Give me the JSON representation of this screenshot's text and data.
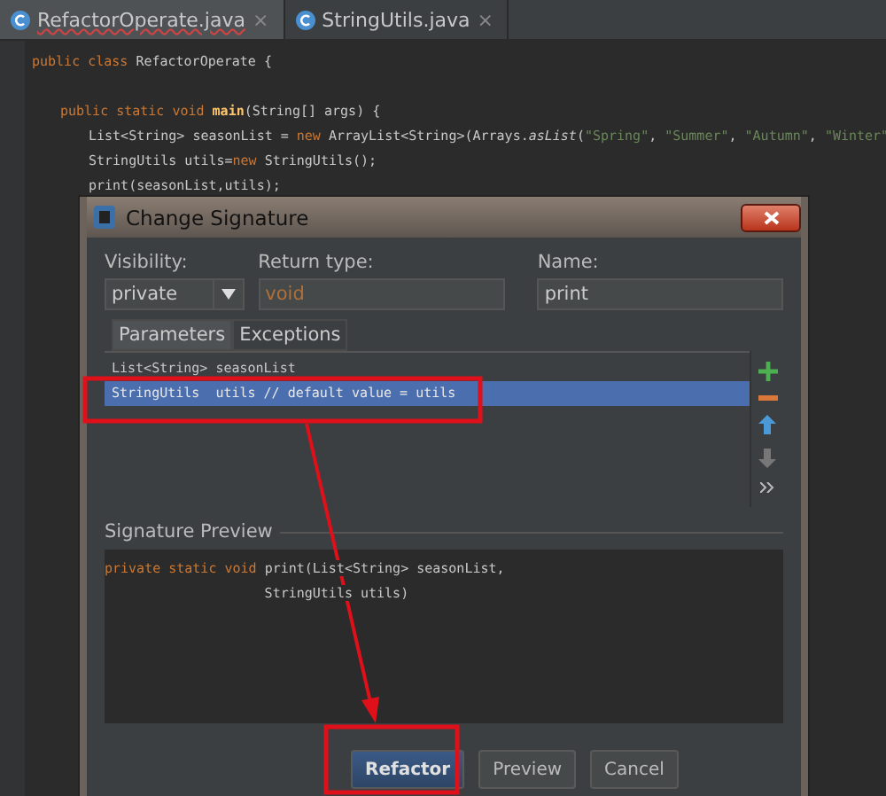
{
  "editor_tabs": [
    {
      "label": "RefactorOperate.java",
      "selected": true,
      "close": "×"
    },
    {
      "label": "StringUtils.java",
      "selected": false,
      "close": "×"
    }
  ],
  "code": [
    {
      "tokens": [
        {
          "kind": "keyword",
          "text": "public class "
        },
        {
          "kind": "plain",
          "text": "RefactorOperate {"
        }
      ],
      "children": [
        {
          "tokens": [
            {
              "kind": "keyword",
              "text": "public static void "
            },
            {
              "kind": "bold",
              "text": "main"
            },
            {
              "kind": "plain",
              "text": "(String[] args) {"
            }
          ],
          "children": [
            {
              "tokens": [
                {
                  "kind": "plain",
                  "text": "List<String> seasonList = "
                },
                {
                  "kind": "keyword",
                  "text": "new "
                },
                {
                  "kind": "plain",
                  "text": "ArrayList<String>(Arrays."
                },
                {
                  "kind": "italic",
                  "text": "asList"
                },
                {
                  "kind": "plain",
                  "text": "("
                },
                {
                  "kind": "string",
                  "text": "\"Spring\""
                },
                {
                  "kind": "plain",
                  "text": ", "
                },
                {
                  "kind": "string",
                  "text": "\"Summer\""
                },
                {
                  "kind": "plain",
                  "text": ", "
                },
                {
                  "kind": "string",
                  "text": "\"Autumn\""
                },
                {
                  "kind": "plain",
                  "text": ", "
                },
                {
                  "kind": "string",
                  "text": "\"Winter\""
                }
              ]
            },
            {
              "tokens": [
                {
                  "kind": "plain",
                  "text": "StringUtils utils="
                },
                {
                  "kind": "keyword",
                  "text": "new "
                },
                {
                  "kind": "plain",
                  "text": "StringUtils();"
                }
              ]
            },
            {
              "tokens": [
                {
                  "kind": "plain",
                  "text": "print(seasonList,utils);"
                }
              ]
            }
          ]
        }
      ]
    }
  ],
  "dialog": {
    "title": "Change Signature",
    "visibility": {
      "label": "Visibility:",
      "value": "private"
    },
    "return_type": {
      "label": "Return type:",
      "value": "void"
    },
    "name": {
      "label": "Name:",
      "value": "print"
    },
    "tabs": [
      {
        "label": "Parameters",
        "selected": true
      },
      {
        "label": "Exceptions",
        "selected": false
      }
    ],
    "parameters": [
      {
        "text": "List<String> seasonList",
        "selected": false
      },
      {
        "text": "StringUtils  utils // default value = utils",
        "selected": true
      }
    ],
    "side_tools": [
      {
        "kind": "add",
        "disabled": false
      },
      {
        "kind": "remove",
        "disabled": false
      },
      {
        "kind": "up",
        "disabled": false
      },
      {
        "kind": "down",
        "disabled": true
      },
      {
        "kind": "more",
        "disabled": false
      }
    ],
    "preview": {
      "label": "Signature Preview",
      "lines": [
        {
          "tokens": [
            {
              "kind": "keyword",
              "text": "private static void "
            },
            {
              "kind": "plain",
              "text": "print(List<String> seasonList,"
            }
          ]
        },
        {
          "tokens": [
            {
              "kind": "plain",
              "text": "                    StringUtils utils)"
            }
          ]
        }
      ]
    },
    "buttons": [
      {
        "label": "Refactor",
        "default": true
      },
      {
        "label": "Preview",
        "default": false
      },
      {
        "label": "Cancel",
        "default": false
      }
    ]
  }
}
